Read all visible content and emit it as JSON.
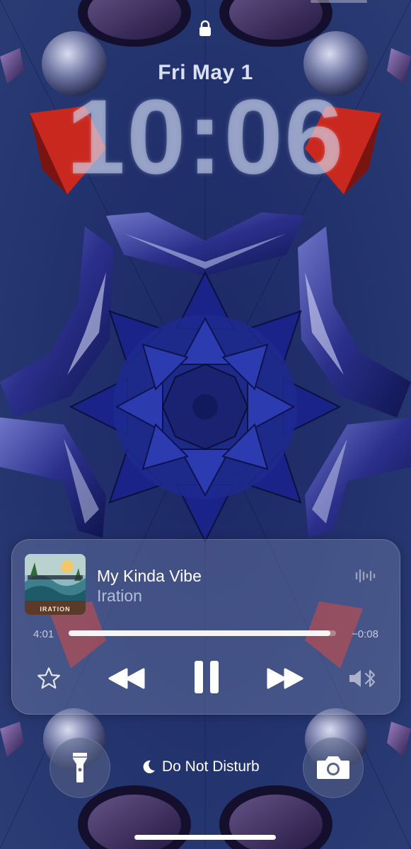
{
  "status": {
    "locked": true
  },
  "lockscreen": {
    "date": "Fri May 1",
    "time": "10:06"
  },
  "now_playing": {
    "title": "My Kinda Vibe",
    "artist": "Iration",
    "album_art_text": "IRATION",
    "elapsed": "4:01",
    "remaining": "−0:08",
    "progress_fraction": 0.98,
    "state": "playing",
    "icons": [
      "waveform-icon",
      "star-icon",
      "rewind-icon",
      "pause-icon",
      "fast-forward-icon",
      "speaker-bluetooth-icon"
    ]
  },
  "focus": {
    "icon": "moon-icon",
    "label": "Do Not Disturb"
  },
  "quick_actions": [
    "flashlight-icon",
    "camera-icon"
  ],
  "colors": {
    "wallpaper_base": "#1c2a63",
    "accent_red": "#c8281e"
  }
}
